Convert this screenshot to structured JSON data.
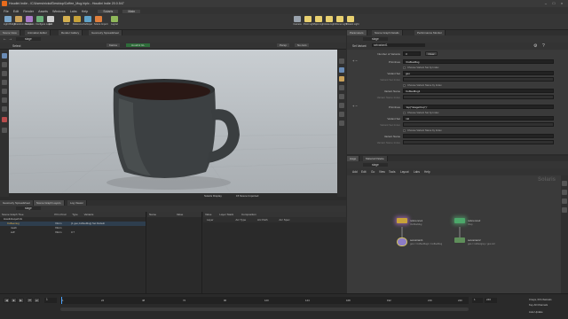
{
  "window": {
    "title": "Houdini Indie - /C/Users/nickd/Desktop/Coffee_Mug.hiplc - Houdini Indie 20.0.547"
  },
  "menu": [
    "File",
    "Edit",
    "Render",
    "Assets",
    "Windows",
    "Labs",
    "Help",
    "Solaris",
    "Main"
  ],
  "shelf_tools": [
    "Light Bridge",
    "Transform Scope",
    "Materials",
    "Configure Layer",
    "Edit",
    "Graft",
    "Reference",
    "Sublayer",
    "Scene Import",
    "Layout"
  ],
  "shelf_right": [
    "Camera",
    "Point Light",
    "Spot Light",
    "Area Light",
    "Dome Light",
    "Distant Light"
  ],
  "left_path_tabs": [
    "Scene View",
    "Animation Editor",
    "Render Gallery",
    "Geometry Spreadsheet"
  ],
  "path": {
    "node": "stage",
    "viewer_label": "Select"
  },
  "viewer": {
    "persp": "Persp",
    "camera": "No cam",
    "render_delegate": "Karma",
    "draw_mode": "Houdini GL",
    "footer_left": "Solaris Display",
    "footer_right": "15 Scene Imported"
  },
  "lower_tabs": [
    "Geometry Spreadsheet",
    "Scene Graph Layers",
    "Log Viewer"
  ],
  "scene_tree": {
    "columns": [
      "Scene Graph Tree",
      "Prim Kind",
      "Type",
      "Variants"
    ],
    "rows": [
      [
        "HoudiniLayerInfo",
        "",
        "",
        ""
      ],
      [
        "Coffeemug",
        "Xform",
        "",
        "{1 geo,CoffeeMug} Set Default"
      ],
      [
        "mesh",
        "Xform",
        "",
        ""
      ],
      [
        "cuff",
        "Xform",
        "",
        "3.7"
      ]
    ]
  },
  "scene_props": {
    "columns": [
      "Name",
      "Value"
    ]
  },
  "scene_tabs2": {
    "tabs": [
      "Value",
      "Layer Stack",
      "Composition"
    ],
    "columns": [
      "Layer",
      "Arc Type",
      "Arc Path",
      "Arc Spec"
    ]
  },
  "param_tabs": [
    "Parameters",
    "Scene Graph Details",
    "Performance Monitor"
  ],
  "param_path": "stage",
  "param_head": {
    "type": "Set Variant",
    "name": "setvariant1"
  },
  "params": [
    {
      "label": "Number of Variants",
      "value": "3",
      "type": "field"
    },
    {
      "label": "Primitives",
      "value": "/CoffeeMug",
      "type": "field"
    },
    {
      "label": "",
      "value": "Choose Variant Set by Index",
      "type": "check"
    },
    {
      "label": "Variant Set",
      "value": "geo",
      "type": "field"
    },
    {
      "label": "Variant Set Index",
      "value": "",
      "type": "field"
    },
    {
      "label": "",
      "value": "Choose Variant Name by Index",
      "type": "check"
    },
    {
      "label": "Variant Name",
      "value": "CoffeeMug1",
      "type": "field"
    },
    {
      "label": "Variant Name Index",
      "value": "",
      "type": "field"
    },
    {
      "label": "Primitives",
      "value": "`lop(\"/stage/Cup\")`",
      "type": "field"
    },
    {
      "label": "",
      "value": "Choose Variant Set by Index",
      "type": "check"
    },
    {
      "label": "Variant Set",
      "value": "mtl",
      "type": "field"
    },
    {
      "label": "Variant Set Index",
      "value": "",
      "type": "field"
    },
    {
      "label": "",
      "value": "Choose Variant Name by Index",
      "type": "check"
    },
    {
      "label": "Variant Name",
      "value": "",
      "type": "field"
    },
    {
      "label": "Variant Name Index",
      "value": "",
      "type": "field"
    }
  ],
  "net_tabs": [
    "stage",
    "Material Palette"
  ],
  "net_path": "stage",
  "net_menu": [
    "Add",
    "Edit",
    "Go",
    "View",
    "Tools",
    "Layout",
    "Labs",
    "Help"
  ],
  "net_context": "Solaris",
  "nodes": [
    {
      "name": "reference1",
      "sub": "/CoffeeMug",
      "color": "#c7a23a"
    },
    {
      "name": "setvariant1",
      "sub": "geo = CoffeeMug1 / CoffeeMug",
      "color": "#8c7cc6"
    },
    {
      "name": "reference2",
      "sub": "/Cup",
      "color": "#4ca86a"
    },
    {
      "name": "setvariant2",
      "sub": "geo = rubbergrey / geo.mtl",
      "color": "#5e8e5a"
    }
  ],
  "timeline": {
    "frame": "1",
    "start": "1",
    "end": "240",
    "ticks": [
      "1",
      "24",
      "48",
      "72",
      "96",
      "120",
      "144",
      "168",
      "192",
      "216",
      "240"
    ],
    "keys_label": "0 keys, 0/0 channels",
    "key_all": "Key All Channels",
    "auto_update": "Auto Update"
  }
}
